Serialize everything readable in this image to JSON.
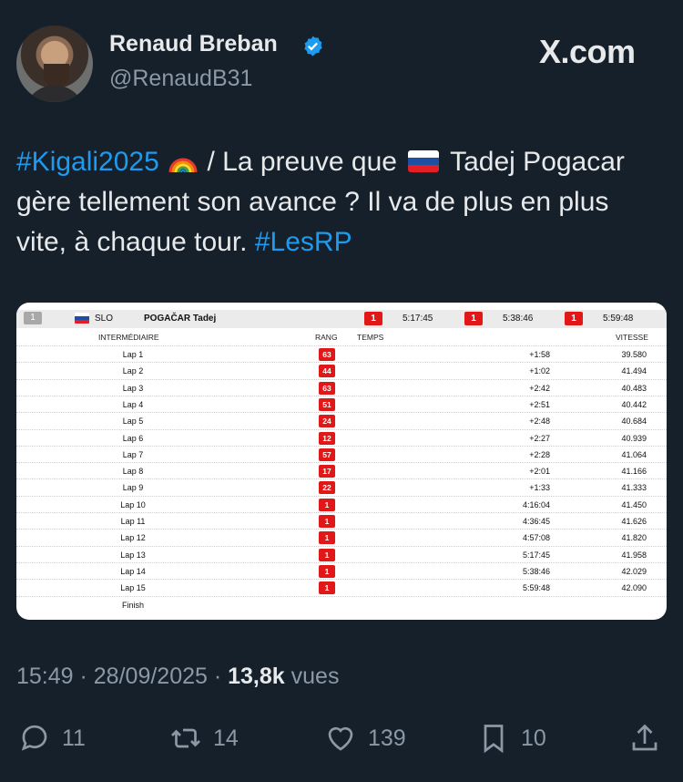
{
  "author": {
    "name": "Renaud Breban",
    "handle": "@RenaudB31",
    "verified": true
  },
  "brand": "X.com",
  "tweet": {
    "hashtag1": "#Kigali2025",
    "text_part1": "/ La preuve que",
    "text_part2": "Tadej Pogacar gère tellement son avance ? Il va de plus en plus vite, à chaque tour.",
    "hashtag2": "#LesRP",
    "emoji_rainbow": "rainbow-icon",
    "flag": "slovenia-flag-icon"
  },
  "card": {
    "position": "1",
    "country": "SLO",
    "rider": "POGAČAR Tadej",
    "splits": [
      {
        "rank": "1",
        "time": "5:17:45"
      },
      {
        "rank": "1",
        "time": "5:38:46"
      },
      {
        "rank": "1",
        "time": "5:59:48"
      }
    ],
    "columns": {
      "intermediate": "INTERMÉDIAIRE",
      "rank": "RANG",
      "time": "TEMPS",
      "speed": "VITESSE"
    },
    "rows": [
      {
        "lap": "Lap 1",
        "rank": "63",
        "time": "+1:58",
        "speed": "39.580"
      },
      {
        "lap": "Lap 2",
        "rank": "44",
        "time": "+1:02",
        "speed": "41.494"
      },
      {
        "lap": "Lap 3",
        "rank": "63",
        "time": "+2:42",
        "speed": "40.483"
      },
      {
        "lap": "Lap 4",
        "rank": "51",
        "time": "+2:51",
        "speed": "40.442"
      },
      {
        "lap": "Lap 5",
        "rank": "24",
        "time": "+2:48",
        "speed": "40.684"
      },
      {
        "lap": "Lap 6",
        "rank": "12",
        "time": "+2:27",
        "speed": "40.939"
      },
      {
        "lap": "Lap 7",
        "rank": "57",
        "time": "+2:28",
        "speed": "41.064"
      },
      {
        "lap": "Lap 8",
        "rank": "17",
        "time": "+2:01",
        "speed": "41.166"
      },
      {
        "lap": "Lap 9",
        "rank": "22",
        "time": "+1:33",
        "speed": "41.333"
      },
      {
        "lap": "Lap 10",
        "rank": "1",
        "time": "4:16:04",
        "speed": "41.450"
      },
      {
        "lap": "Lap 11",
        "rank": "1",
        "time": "4:36:45",
        "speed": "41.626"
      },
      {
        "lap": "Lap 12",
        "rank": "1",
        "time": "4:57:08",
        "speed": "41.820"
      },
      {
        "lap": "Lap 13",
        "rank": "1",
        "time": "5:17:45",
        "speed": "41.958"
      },
      {
        "lap": "Lap 14",
        "rank": "1",
        "time": "5:38:46",
        "speed": "42.029"
      },
      {
        "lap": "Lap 15",
        "rank": "1",
        "time": "5:59:48",
        "speed": "42.090"
      },
      {
        "lap": "Finish",
        "rank": "",
        "time": "",
        "speed": ""
      }
    ]
  },
  "meta": {
    "time": "15:49",
    "date": "28/09/2025",
    "views_count": "13,8k",
    "views_label": "vues"
  },
  "actions": {
    "replies": "11",
    "reposts": "14",
    "likes": "139",
    "bookmarks": "10"
  },
  "colors": {
    "background": "#15202b",
    "link": "#1d9bf0",
    "muted": "#8b98a5",
    "rank_red": "#e01818"
  }
}
